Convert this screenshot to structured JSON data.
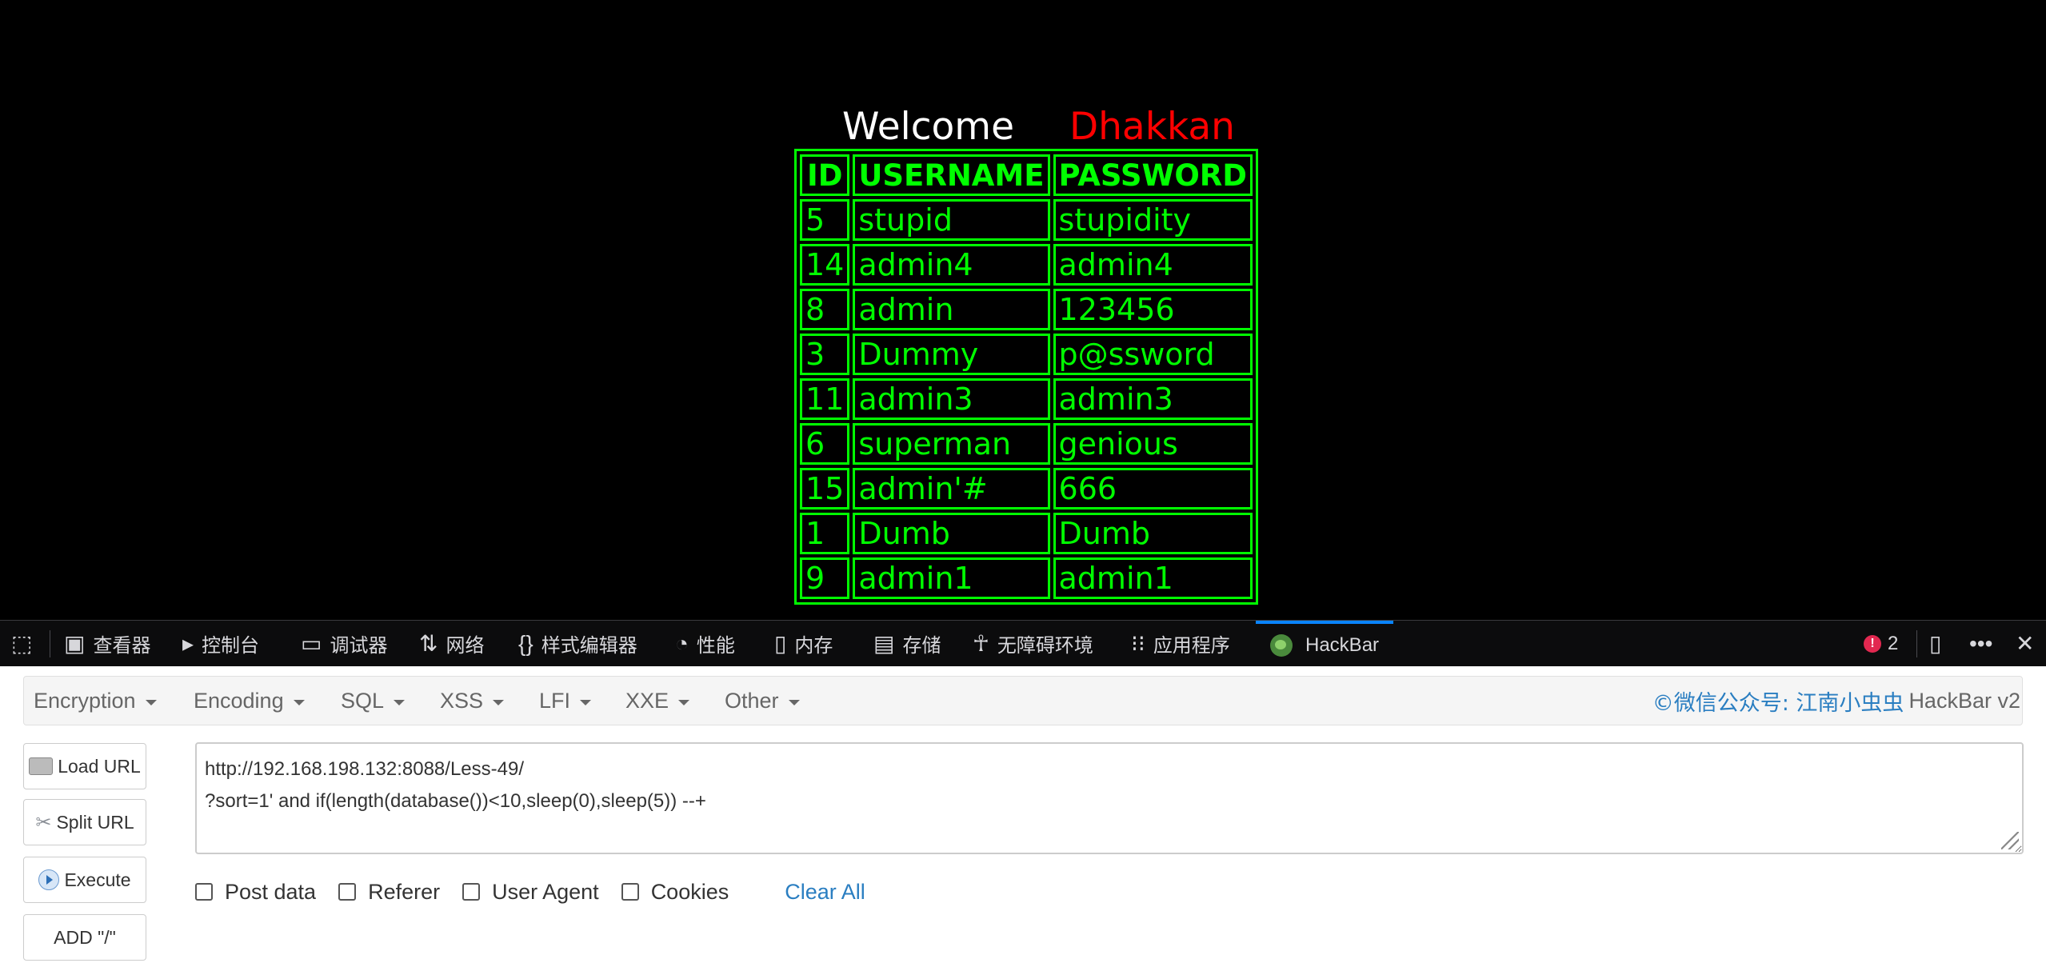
{
  "page": {
    "welcome_word": "Welcome",
    "welcome_name": "Dhakkan",
    "table": {
      "headers": [
        "ID",
        "USERNAME",
        "PASSWORD"
      ],
      "rows": [
        [
          "5",
          "stupid",
          "stupidity"
        ],
        [
          "14",
          "admin4",
          "admin4"
        ],
        [
          "8",
          "admin",
          "123456"
        ],
        [
          "3",
          "Dummy",
          "p@ssword"
        ],
        [
          "11",
          "admin3",
          "admin3"
        ],
        [
          "6",
          "superman",
          "genious"
        ],
        [
          "15",
          "admin'#",
          "666"
        ],
        [
          "1",
          "Dumb",
          "Dumb"
        ],
        [
          "9",
          "admin1",
          "admin1"
        ]
      ]
    }
  },
  "devtools": {
    "tabs": [
      {
        "label": "查看器",
        "icon": "inspector-icon"
      },
      {
        "label": "控制台",
        "icon": "console-icon"
      },
      {
        "label": "调试器",
        "icon": "debugger-icon"
      },
      {
        "label": "网络",
        "icon": "network-icon"
      },
      {
        "label": "样式编辑器",
        "icon": "style-editor-icon"
      },
      {
        "label": "性能",
        "icon": "performance-icon"
      },
      {
        "label": "内存",
        "icon": "memory-icon"
      },
      {
        "label": "存储",
        "icon": "storage-icon"
      },
      {
        "label": "无障碍环境",
        "icon": "accessibility-icon"
      },
      {
        "label": "应用程序",
        "icon": "application-icon"
      },
      {
        "label": "HackBar",
        "icon": "hackbar-logo-icon"
      }
    ],
    "active_tab": "HackBar",
    "error_count": "2",
    "active_color": "#0a84ff",
    "error_color": "#e22850"
  },
  "hackbar": {
    "menu": [
      "Encryption",
      "Encoding",
      "SQL",
      "XSS",
      "LFI",
      "XXE",
      "Other"
    ],
    "credit_link": "©微信公众号: 江南小虫虫",
    "credit_version": "HackBar v2",
    "buttons": {
      "load_url": "Load URL",
      "split_url": "Split URL",
      "execute": "Execute",
      "add_slash": "ADD \"/\""
    },
    "url_lines": [
      "http://192.168.198.132:8088/Less-49/",
      "?sort=1' and if(length(database())<10,sleep(0),sleep(5)) --+"
    ],
    "options": [
      "Post data",
      "Referer",
      "User Agent",
      "Cookies"
    ],
    "clear_all": "Clear All",
    "link_color": "#2a7ec1"
  }
}
